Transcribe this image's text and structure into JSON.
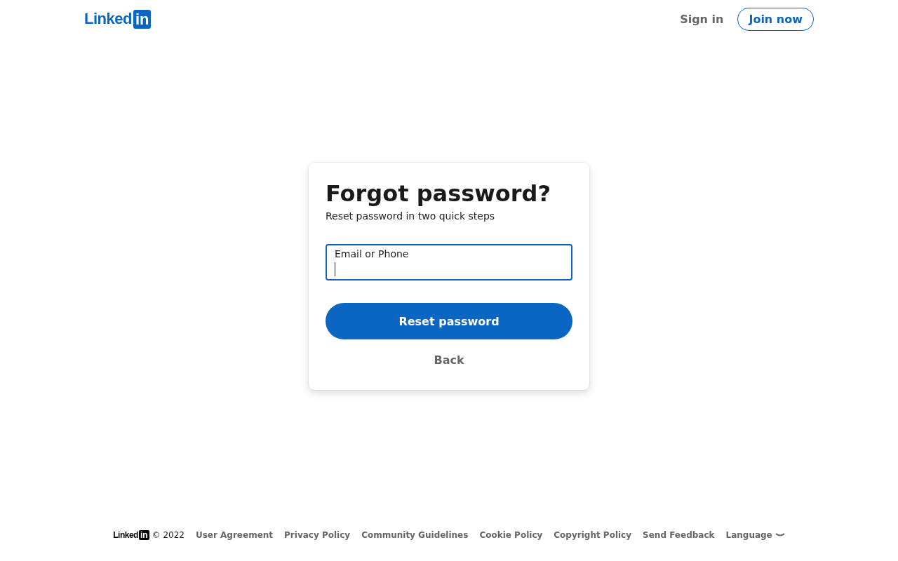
{
  "header": {
    "logo": {
      "text": "Linked",
      "badge": "in"
    },
    "sign_in": "Sign in",
    "join_now": "Join now"
  },
  "card": {
    "title": "Forgot password?",
    "subtitle": "Reset password in two quick steps",
    "field": {
      "label": "Email or Phone",
      "focused": true
    },
    "submit": "Reset password",
    "back": "Back"
  },
  "footer": {
    "logo": {
      "text": "Linked",
      "badge": "in"
    },
    "copyright": "© 2022",
    "links": [
      "User Agreement",
      "Privacy Policy",
      "Community Guidelines",
      "Cookie Policy",
      "Copyright Policy",
      "Send Feedback"
    ],
    "language": "Language"
  }
}
